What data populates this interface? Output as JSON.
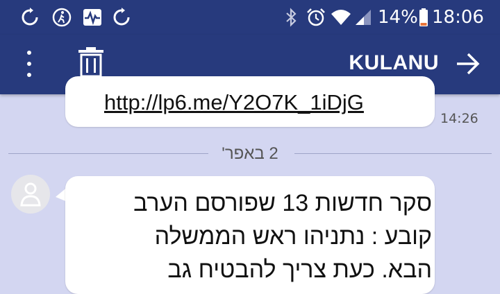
{
  "status_bar": {
    "battery_percent": "14%",
    "time": "18:06",
    "icons": [
      "sync-icon",
      "walk-icon",
      "activity-icon",
      "sync-icon",
      "bluetooth-icon",
      "alarm-icon",
      "wifi-icon",
      "signal-icon",
      "battery-icon"
    ]
  },
  "app_bar": {
    "title": "KULANU",
    "icons": [
      "more-vert-icon",
      "delete-icon",
      "forward-arrow-icon"
    ]
  },
  "messages": {
    "prev": {
      "link": "http://lp6.me/Y2O7K_1iDjG",
      "time": "14:26"
    },
    "date_divider": "2 באפר'",
    "current": {
      "lines": [
        "סקר חדשות 13 שפורסם הערב",
        "קובע : נתניהו ראש הממשלה",
        "הבא. כעת צריך להבטיח גב"
      ]
    }
  },
  "colors": {
    "bar": "#273a7d",
    "background": "#d3d6f1",
    "bubble": "#ffffff"
  }
}
